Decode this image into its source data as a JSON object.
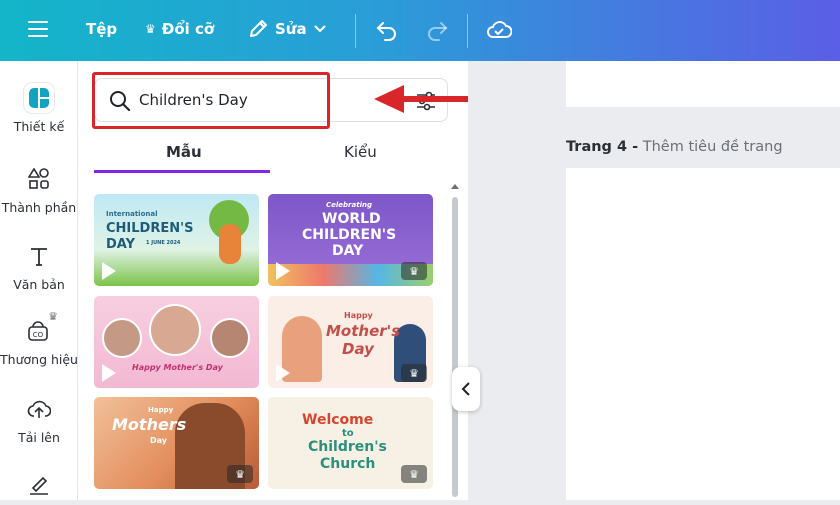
{
  "topbar": {
    "menu_icon": "hamburger-icon",
    "file_label": "Tệp",
    "resize_label": "Đổi cỡ",
    "edit_label": "Sửa",
    "colors": {
      "gradient_start": "#13b5c9",
      "gradient_end": "#5b5ee6"
    }
  },
  "rail": {
    "items": [
      {
        "label": "Thiết kế",
        "icon": "design-icon"
      },
      {
        "label": "Thành phần",
        "icon": "elements-icon"
      },
      {
        "label": "Văn bản",
        "icon": "text-icon"
      },
      {
        "label": "Thương hiệu",
        "icon": "brand-icon"
      },
      {
        "label": "Tải lên",
        "icon": "upload-icon"
      }
    ]
  },
  "search": {
    "value": "Children's Day"
  },
  "tabs": [
    {
      "label": "Mẫu",
      "active": true
    },
    {
      "label": "Kiểu",
      "active": false
    }
  ],
  "templates": [
    {
      "lines": [
        "International",
        "CHILDREN'S",
        "DAY",
        "1 JUNE 2024"
      ],
      "video": true,
      "premium": false
    },
    {
      "lines": [
        "Celebrating",
        "WORLD",
        "CHILDREN'S",
        "DAY"
      ],
      "video": true,
      "premium": true
    },
    {
      "lines": [
        "Happy Mother's Day"
      ],
      "video": true,
      "premium": false
    },
    {
      "lines": [
        "Happy",
        "Mother's",
        "Day"
      ],
      "video": true,
      "premium": true
    },
    {
      "lines": [
        "Happy",
        "Mothers",
        "Day"
      ],
      "video": false,
      "premium": true
    },
    {
      "lines": [
        "Welcome",
        "to",
        "Children's",
        "Church"
      ],
      "video": false,
      "premium": true
    }
  ],
  "canvas": {
    "page_number": "Trang 4 -",
    "page_title_placeholder": "Thêm tiêu đề trang"
  },
  "accent": "#7d2ae8",
  "highlight_color": "#d9262a"
}
